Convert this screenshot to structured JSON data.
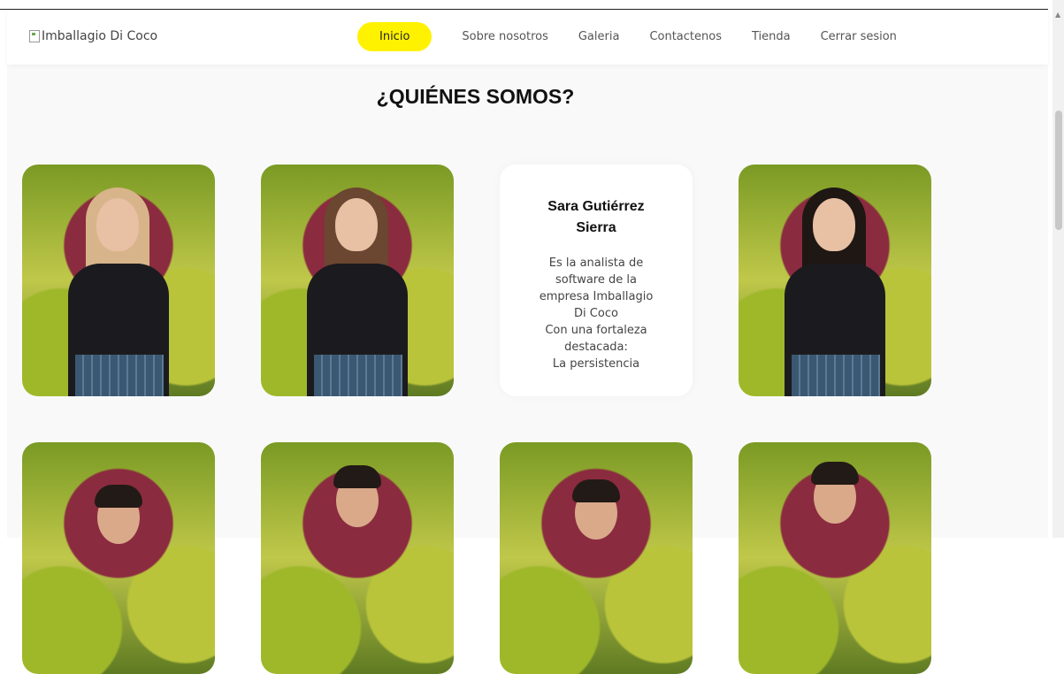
{
  "header": {
    "logo_alt": "Imballagio Di Coco",
    "nav": [
      "Inicio",
      "Sobre nosotros",
      "Galeria",
      "Contactenos",
      "Tienda",
      "Cerrar sesion"
    ]
  },
  "main": {
    "title": "¿QUIÉNES SOMOS?",
    "info_card": {
      "name": "Sara Gutiérrez\nSierra",
      "description": "Es la analista de\nsoftware de la\nempresa Imballagio\nDi Coco\nCon una fortaleza\ndestacada:\nLa persistencia"
    }
  },
  "colors": {
    "accent": "#fff200",
    "background": "#f9f9f9"
  }
}
